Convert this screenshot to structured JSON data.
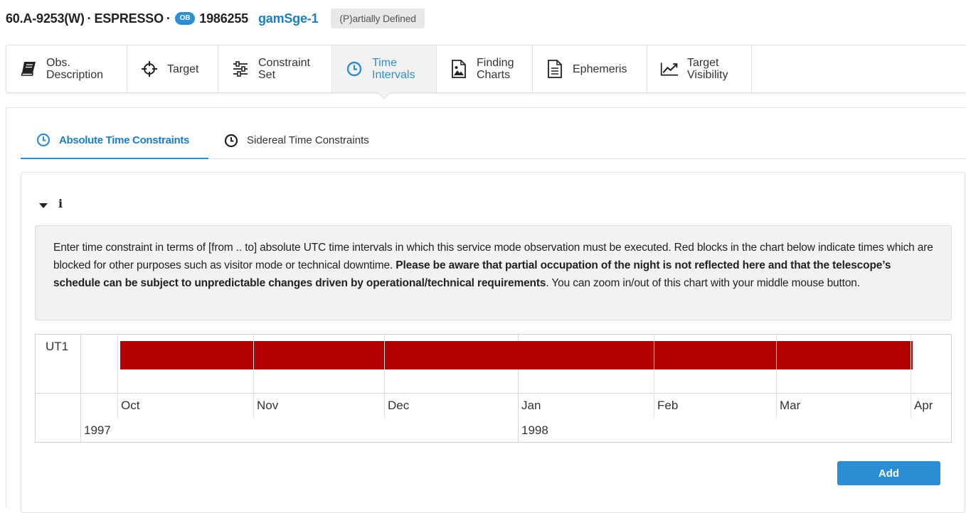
{
  "header": {
    "program_id": "60.A-9253(W)",
    "separator": "·",
    "instrument": "ESPRESSO",
    "ob_badge": "OB",
    "ob_id": "1986255",
    "ob_name": "gamSge-1",
    "status": "(P)artially Defined"
  },
  "tabs": [
    {
      "id": "obs-description",
      "line1": "Obs.",
      "line2": "Description",
      "icon": "book-icon"
    },
    {
      "id": "target",
      "line1": "Target",
      "line2": "",
      "icon": "crosshair-icon"
    },
    {
      "id": "constraint-set",
      "line1": "Constraint",
      "line2": "Set",
      "icon": "sliders-icon"
    },
    {
      "id": "time-intervals",
      "line1": "Time",
      "line2": "Intervals",
      "icon": "clock-icon",
      "active": true
    },
    {
      "id": "finding-charts",
      "line1": "Finding",
      "line2": "Charts",
      "icon": "image-icon"
    },
    {
      "id": "ephemeris",
      "line1": "Ephemeris",
      "line2": "",
      "icon": "document-icon"
    },
    {
      "id": "target-visibility",
      "line1": "Target",
      "line2": "Visibility",
      "icon": "line-chart-icon"
    }
  ],
  "subtabs": {
    "absolute": "Absolute Time Constraints",
    "sidereal": "Sidereal Time Constraints"
  },
  "info": {
    "text_part1": "Enter time constraint in terms of [from .. to] absolute UTC time intervals in which this service mode observation must be executed. Red blocks in the chart below indicate times which are blocked for other purposes such as visitor mode or technical downtime. ",
    "text_bold": "Please be aware that partial occupation of the night is not reflected here and that the telescope’s schedule can be subject to unpredictable changes driven by operational/technical requirements",
    "text_part2": ". You can zoom in/out of this chart with your middle mouse button."
  },
  "timeline": {
    "row_label": "UT1",
    "months": [
      "Oct",
      "Nov",
      "Dec",
      "Jan",
      "Feb",
      "Mar",
      "Apr"
    ],
    "years": [
      "1997",
      "1998"
    ],
    "blocked_start": "1997-10-01",
    "blocked_end": "1998-03-31",
    "blocked_color": "#b30000"
  },
  "buttons": {
    "add": "Add"
  },
  "colors": {
    "accent": "#2b8fd6",
    "blocked": "#b30000"
  }
}
